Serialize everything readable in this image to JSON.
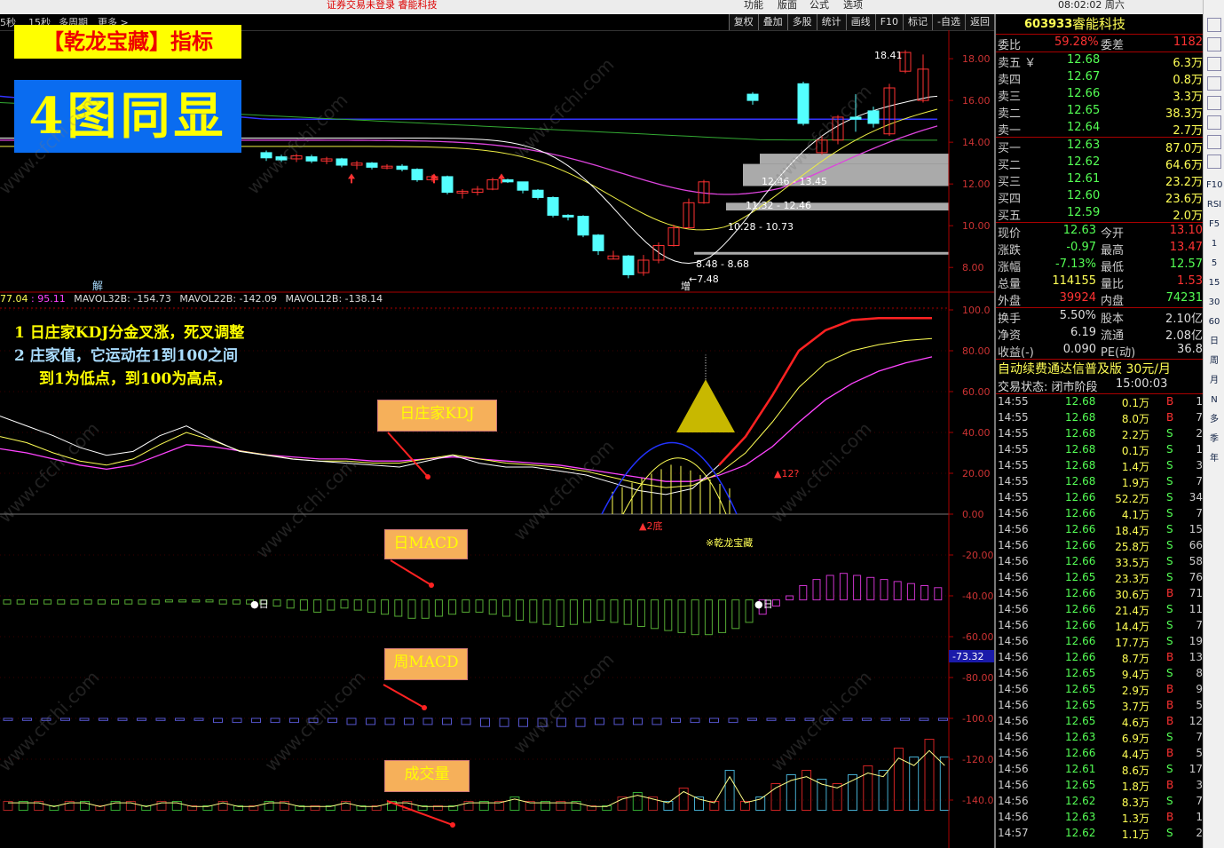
{
  "topbar": {
    "title": "证券交易未登录  睿能科技",
    "menus": [
      "功能",
      "版面",
      "公式",
      "选项"
    ],
    "clock": "08:02:02 周六"
  },
  "period": {
    "items": [
      "5秒",
      "15秒",
      "多周期",
      "更多 >"
    ]
  },
  "toolbar": [
    "复权",
    "叠加",
    "多股",
    "统计",
    "画线",
    "F10",
    "标记",
    "-自选",
    "返回"
  ],
  "banners": {
    "title": "【乾龙宝藏】指标",
    "big": "4图同显"
  },
  "notes": {
    "line1": "1  日庄家KDJ分金叉涨，死叉调整",
    "line2": "2  庄家值，它运动在1到100之间",
    "line3": "到1为低点，到100为高点，"
  },
  "labels": {
    "kdj": "日庄家KDJ",
    "dmacd": "日MACD",
    "wmacd": "周MACD",
    "vol": "成交量"
  },
  "indicator_row": {
    "v1": "77.04",
    "v2": ": 95.11",
    "mav32": "MAVOL32B: -154.73",
    "mav22": "MAVOL22B: -142.09",
    "mav12": "MAVOL12B: -138.14"
  },
  "chart_text": {
    "high_label": "18.41",
    "low_label": "←7.48",
    "box1": "12.46 - 13.45",
    "box2": "11.32 - 12.46",
    "box3": "10.28 - 10.73",
    "box4": "8.48 - 8.68",
    "jie": "解",
    "zeng": "增",
    "ridi1": "●日",
    "ridi2": "●日",
    "twobottom": "▲2底",
    "q12": "▲12?",
    "qianlong": "※乾龙宝藏",
    "current_val": "-73.32"
  },
  "price_axis": [
    "18.00",
    "16.00",
    "14.00",
    "12.00",
    "10.00",
    "8.00"
  ],
  "osc_axis": [
    "100.0",
    "80.00",
    "60.00",
    "40.00",
    "20.00",
    "0.00",
    "-20.00",
    "-40.00",
    "-60.00",
    "-80.00",
    "-100.0",
    "-120.0",
    "-140.0"
  ],
  "stock": {
    "code": "603933",
    "name": "睿能科技",
    "weibi_label": "委比",
    "weibi": "59.28%",
    "weicha_label": "委差",
    "weicha": "1182"
  },
  "asks": [
    {
      "label": "卖五 ￥",
      "price": "12.68",
      "vol": "6.3万"
    },
    {
      "label": "卖四",
      "price": "12.67",
      "vol": "0.8万"
    },
    {
      "label": "卖三",
      "price": "12.66",
      "vol": "3.3万"
    },
    {
      "label": "卖二",
      "price": "12.65",
      "vol": "38.3万"
    },
    {
      "label": "卖一",
      "price": "12.64",
      "vol": "2.7万"
    }
  ],
  "bids": [
    {
      "label": "买一",
      "price": "12.63",
      "vol": "87.0万"
    },
    {
      "label": "买二",
      "price": "12.62",
      "vol": "64.6万"
    },
    {
      "label": "买三",
      "price": "12.61",
      "vol": "23.2万"
    },
    {
      "label": "买四",
      "price": "12.60",
      "vol": "23.6万"
    },
    {
      "label": "买五",
      "price": "12.59",
      "vol": "2.0万"
    }
  ],
  "quote": [
    {
      "l1": "现价",
      "v1": "12.63",
      "l2": "今开",
      "v2": "13.10"
    },
    {
      "l1": "涨跌",
      "v1": "-0.97",
      "l2": "最高",
      "v2": "13.47"
    },
    {
      "l1": "涨幅",
      "v1": "-7.13%",
      "l2": "最低",
      "v2": "12.57"
    },
    {
      "l1": "总量",
      "v1": "114155",
      "l2": "量比",
      "v2": "1.53"
    },
    {
      "l1": "外盘",
      "v1": "39924",
      "l2": "内盘",
      "v2": "74231"
    }
  ],
  "fund": [
    {
      "l1": "换手",
      "v1": "5.50%",
      "l2": "股本",
      "v2": "2.10亿"
    },
    {
      "l1": "净资",
      "v1": "6.19",
      "l2": "流通",
      "v2": "2.08亿"
    },
    {
      "l1": "收益(-)",
      "v1": "0.090",
      "l2": "PE(动)",
      "v2": "36.8"
    }
  ],
  "promo": "自动续费通达信普及版  30元/月",
  "trade_state": {
    "label": "交易状态: 闭市阶段",
    "time": "15:00:03"
  },
  "ticks": [
    {
      "t": "14:55",
      "p": "12.68",
      "v": "0.1万",
      "bs": "B",
      "n": "1"
    },
    {
      "t": "14:55",
      "p": "12.68",
      "v": "8.0万",
      "bs": "B",
      "n": "7"
    },
    {
      "t": "14:55",
      "p": "12.68",
      "v": "2.2万",
      "bs": "S",
      "n": "2"
    },
    {
      "t": "14:55",
      "p": "12.68",
      "v": "0.1万",
      "bs": "S",
      "n": "1"
    },
    {
      "t": "14:55",
      "p": "12.68",
      "v": "1.4万",
      "bs": "S",
      "n": "3"
    },
    {
      "t": "14:55",
      "p": "12.68",
      "v": "1.9万",
      "bs": "S",
      "n": "7"
    },
    {
      "t": "14:55",
      "p": "12.66",
      "v": "52.2万",
      "bs": "S",
      "n": "34"
    },
    {
      "t": "14:56",
      "p": "12.66",
      "v": "4.1万",
      "bs": "S",
      "n": "7"
    },
    {
      "t": "14:56",
      "p": "12.66",
      "v": "18.4万",
      "bs": "S",
      "n": "15"
    },
    {
      "t": "14:56",
      "p": "12.66",
      "v": "25.8万",
      "bs": "S",
      "n": "66"
    },
    {
      "t": "14:56",
      "p": "12.66",
      "v": "33.5万",
      "bs": "S",
      "n": "58"
    },
    {
      "t": "14:56",
      "p": "12.65",
      "v": "23.3万",
      "bs": "S",
      "n": "76"
    },
    {
      "t": "14:56",
      "p": "12.66",
      "v": "30.6万",
      "bs": "B",
      "n": "71"
    },
    {
      "t": "14:56",
      "p": "12.66",
      "v": "21.4万",
      "bs": "S",
      "n": "11"
    },
    {
      "t": "14:56",
      "p": "12.66",
      "v": "14.4万",
      "bs": "S",
      "n": "7"
    },
    {
      "t": "14:56",
      "p": "12.66",
      "v": "17.7万",
      "bs": "S",
      "n": "19"
    },
    {
      "t": "14:56",
      "p": "12.66",
      "v": "8.7万",
      "bs": "B",
      "n": "13"
    },
    {
      "t": "14:56",
      "p": "12.65",
      "v": "9.4万",
      "bs": "S",
      "n": "8"
    },
    {
      "t": "14:56",
      "p": "12.65",
      "v": "2.9万",
      "bs": "B",
      "n": "9"
    },
    {
      "t": "14:56",
      "p": "12.65",
      "v": "3.7万",
      "bs": "B",
      "n": "5"
    },
    {
      "t": "14:56",
      "p": "12.65",
      "v": "4.6万",
      "bs": "B",
      "n": "12"
    },
    {
      "t": "14:56",
      "p": "12.63",
      "v": "6.9万",
      "bs": "S",
      "n": "7"
    },
    {
      "t": "14:56",
      "p": "12.66",
      "v": "4.4万",
      "bs": "B",
      "n": "5"
    },
    {
      "t": "14:56",
      "p": "12.61",
      "v": "8.6万",
      "bs": "S",
      "n": "17"
    },
    {
      "t": "14:56",
      "p": "12.65",
      "v": "1.8万",
      "bs": "B",
      "n": "3"
    },
    {
      "t": "14:56",
      "p": "12.62",
      "v": "8.3万",
      "bs": "S",
      "n": "7"
    },
    {
      "t": "14:56",
      "p": "12.63",
      "v": "1.3万",
      "bs": "B",
      "n": "1"
    },
    {
      "t": "14:57",
      "p": "12.62",
      "v": "1.1万",
      "bs": "S",
      "n": "2"
    }
  ],
  "sidebar": [
    "F10",
    "RSI",
    "F5",
    "1",
    "5",
    "15",
    "30",
    "60",
    "日",
    "周",
    "月",
    "N",
    "多",
    "季",
    "年"
  ],
  "watermark": "www.cfchi.com",
  "colors": {
    "up": "#ff3232",
    "down": "#54ffff",
    "kdj_white": "#ffffff",
    "kdj_yellow": "#ffff55",
    "kdj_magenta": "#ff44ff",
    "macd_green": "#55aa33",
    "macd_magenta": "#cc33cc",
    "wmacd_blue": "#5555cc",
    "banner_yellow": "#ffff00",
    "banner_blue": "#0a6cf0",
    "label_orange": "#f6b05a"
  },
  "chart_data": {
    "type": "candlestick",
    "ma_lines": [
      "white",
      "yellow",
      "magenta",
      "green",
      "blue"
    ],
    "price_ylim": [
      7.2,
      18.6
    ],
    "candles": [
      {
        "o": 13.5,
        "c": 13.25,
        "h": 13.6,
        "l": 13.1
      },
      {
        "o": 13.3,
        "c": 13.15,
        "h": 13.4,
        "l": 13.05
      },
      {
        "o": 13.2,
        "c": 13.35,
        "h": 13.45,
        "l": 13.05
      },
      {
        "o": 13.3,
        "c": 13.1,
        "h": 13.4,
        "l": 13.0
      },
      {
        "o": 13.1,
        "c": 13.2,
        "h": 13.3,
        "l": 12.95
      },
      {
        "o": 13.2,
        "c": 12.9,
        "h": 13.25,
        "l": 12.8
      },
      {
        "o": 12.9,
        "c": 13.0,
        "h": 13.1,
        "l": 12.7
      },
      {
        "o": 13.0,
        "c": 12.8,
        "h": 13.05,
        "l": 12.7
      },
      {
        "o": 12.8,
        "c": 12.85,
        "h": 12.95,
        "l": 12.7
      },
      {
        "o": 12.85,
        "c": 12.7,
        "h": 12.95,
        "l": 12.6
      },
      {
        "o": 12.7,
        "c": 12.2,
        "h": 12.75,
        "l": 12.1
      },
      {
        "o": 12.2,
        "c": 12.35,
        "h": 12.45,
        "l": 12.1
      },
      {
        "o": 12.35,
        "c": 11.6,
        "h": 12.4,
        "l": 11.5
      },
      {
        "o": 11.6,
        "c": 11.65,
        "h": 11.75,
        "l": 11.3
      },
      {
        "o": 11.6,
        "c": 11.75,
        "h": 11.9,
        "l": 11.45
      },
      {
        "o": 11.75,
        "c": 12.2,
        "h": 12.3,
        "l": 11.7
      },
      {
        "o": 12.2,
        "c": 12.1,
        "h": 12.25,
        "l": 12.05
      },
      {
        "o": 12.1,
        "c": 11.7,
        "h": 12.1,
        "l": 11.55
      },
      {
        "o": 11.7,
        "c": 11.35,
        "h": 11.75,
        "l": 11.25
      },
      {
        "o": 11.35,
        "c": 10.5,
        "h": 11.4,
        "l": 10.4
      },
      {
        "o": 10.5,
        "c": 10.45,
        "h": 10.55,
        "l": 10.25
      },
      {
        "o": 10.45,
        "c": 9.55,
        "h": 10.5,
        "l": 9.45
      },
      {
        "o": 9.55,
        "c": 8.8,
        "h": 9.6,
        "l": 8.6
      },
      {
        "o": 8.4,
        "c": 8.55,
        "h": 8.8,
        "l": 8.4
      },
      {
        "o": 8.55,
        "c": 7.65,
        "h": 8.6,
        "l": 7.48
      },
      {
        "o": 7.75,
        "c": 8.35,
        "h": 8.6,
        "l": 7.6
      },
      {
        "o": 8.35,
        "c": 9.05,
        "h": 9.2,
        "l": 8.2
      },
      {
        "o": 9.05,
        "c": 9.9,
        "h": 10.05,
        "l": 9.0
      },
      {
        "o": 9.9,
        "c": 11.1,
        "h": 11.3,
        "l": 9.9
      },
      {
        "o": 11.1,
        "c": 12.1,
        "h": 12.2,
        "l": 11.05
      },
      {
        "o": 16.3,
        "c": 16.0,
        "h": 16.4,
        "l": 15.8
      },
      {
        "o": 16.8,
        "c": 14.9,
        "h": 16.9,
        "l": 14.8
      },
      {
        "o": 13.5,
        "c": 14.1,
        "h": 14.3,
        "l": 13.4
      },
      {
        "o": 14.1,
        "c": 15.2,
        "h": 15.3,
        "l": 13.9
      },
      {
        "o": 15.2,
        "c": 15.1,
        "h": 16.3,
        "l": 14.5
      },
      {
        "o": 15.5,
        "c": 14.9,
        "h": 15.7,
        "l": 14.7
      },
      {
        "o": 14.4,
        "c": 16.6,
        "h": 16.8,
        "l": 14.3
      },
      {
        "o": 17.4,
        "c": 18.3,
        "h": 18.41,
        "l": 17.3
      },
      {
        "o": 16.0,
        "c": 17.5,
        "h": 18.2,
        "l": 15.9
      }
    ],
    "kdj_ylim": [
      0,
      100
    ],
    "kdj_k": [
      50,
      45,
      40,
      34,
      30,
      32,
      40,
      45,
      38,
      32,
      30,
      28,
      27,
      26,
      25,
      24,
      27,
      30,
      26,
      24,
      24,
      22,
      20,
      16,
      12,
      10,
      13,
      24,
      38,
      58,
      80,
      90,
      95,
      96,
      96,
      96
    ],
    "kdj_d": [
      38,
      35,
      30,
      26,
      24,
      27,
      34,
      40,
      36,
      31,
      29,
      27,
      26,
      26,
      25,
      25,
      27,
      29,
      27,
      25,
      24,
      23,
      21,
      18,
      15,
      13,
      14,
      20,
      30,
      45,
      62,
      74,
      80,
      83,
      85,
      86
    ],
    "kdj_j": [
      32,
      30,
      27,
      24,
      22,
      24,
      29,
      34,
      33,
      31,
      29,
      28,
      27,
      27,
      26,
      26,
      27,
      28,
      27,
      26,
      25,
      24,
      22,
      20,
      18,
      16,
      16,
      19,
      24,
      33,
      45,
      56,
      64,
      70,
      74,
      77
    ],
    "dmacd": [
      -44,
      -44,
      -44,
      -44,
      -44,
      -44,
      -44,
      -44,
      -44,
      -44,
      -44,
      -44,
      -43,
      -43,
      -43,
      -43,
      -44,
      -44,
      -44,
      -44,
      -45,
      -46,
      -47,
      -48,
      -47,
      -46,
      -47,
      -48,
      -49,
      -50,
      -51,
      -51,
      -50,
      -49,
      -48,
      -48,
      -49,
      -50,
      -52,
      -53,
      -54,
      -55,
      -54,
      -53,
      -52,
      -53,
      -54,
      -55,
      -56,
      -57,
      -58,
      -59,
      -59,
      -58,
      -56,
      -53,
      -49,
      -45,
      -40,
      -35,
      -32,
      -30,
      -29,
      -30,
      -31,
      -32,
      -33,
      -34,
      -35,
      -36
    ],
    "wmacd": [
      -101,
      -101,
      -101,
      -101,
      -101,
      -101,
      -101,
      -101,
      -101,
      -101,
      -101,
      -102,
      -102,
      -102,
      -102,
      -102,
      -102,
      -102,
      -103,
      -103,
      -103,
      -103,
      -103,
      -103,
      -103,
      -104,
      -104,
      -104,
      -104,
      -104,
      -104,
      -103,
      -103,
      -103,
      -103,
      -102,
      -102,
      -102,
      -102,
      -101,
      -101,
      -101,
      -101,
      -101,
      -101,
      -101,
      -101,
      -101,
      -101,
      -101
    ],
    "volume": [
      2,
      2,
      2,
      1,
      2,
      2,
      1,
      2,
      2,
      1,
      2,
      2,
      1,
      1,
      2,
      1,
      1,
      2,
      2,
      1,
      1,
      1,
      2,
      1,
      1,
      2,
      2,
      1,
      1,
      1,
      2,
      2,
      2,
      3,
      2,
      2,
      2,
      2,
      1,
      1,
      3,
      4,
      3,
      2,
      5,
      3,
      2,
      9,
      2,
      3,
      6,
      8,
      9,
      7,
      6,
      8,
      10,
      9,
      14,
      12,
      16,
      12
    ],
    "osc_ylim": [
      -150,
      100
    ]
  }
}
